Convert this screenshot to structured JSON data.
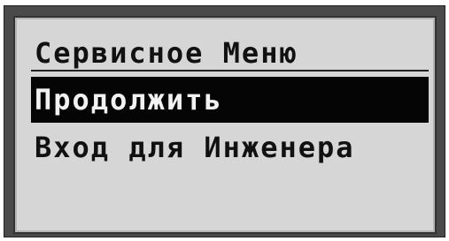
{
  "screen": {
    "title": "Сервисное Меню",
    "items": [
      {
        "label": "Продолжить",
        "selected": true
      },
      {
        "label": "Вход для Инженера",
        "selected": false
      }
    ]
  },
  "colors": {
    "lcd_background": "#d6d6d6",
    "text": "#111111",
    "highlight_background": "#050505",
    "highlight_text": "#f2f2f2",
    "frame": "#4a4a4a"
  }
}
